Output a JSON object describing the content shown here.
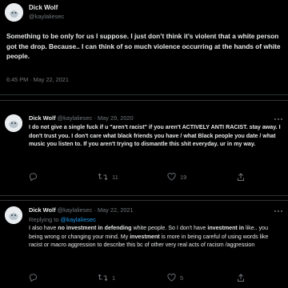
{
  "tweet1": {
    "display_name": "Dick Wolf",
    "handle": "@kaylaliesec",
    "text": "Something to be only for us I suppose. I just don’t think it’s violent that a white person got the drop. Because.. I can think of so much violence occurring at the hands of white people.",
    "timestamp": "6:45 PM · May 22, 2021"
  },
  "tweet2": {
    "display_name": "Dick Wolf",
    "handle": "@kaylaliesec",
    "dot": "·",
    "date": "May 29, 2020",
    "text_a": "I do not give a single fuck if u \"aren't racist\" if you aren't ",
    "text_b": "ACTIVELY ANTI RACIST",
    "text_c": ". stay away. I don't trust you. I don't care what black friends you have / what Black people you date / what music you listen to. If you aren't trying to dismantle this shit everyday. ur in my way.",
    "replies": "",
    "retweets": "11",
    "likes": "19"
  },
  "tweet3": {
    "display_name": "Dick Wolf",
    "handle": "@kaylaliesec",
    "dot": "·",
    "date": "May 22, 2021",
    "replying_prefix": "Replying to ",
    "replying_handle": "@kaylaliesec",
    "text_a": "I also have ",
    "text_b": "no investment in defending",
    "text_c": " white people. So I don't have ",
    "text_d": "investment in",
    "text_e": " like.. you being wrong or changing your mind. My ",
    "text_f": "investment",
    "text_g": " is more in being careful of using words like racist or macro aggression to describe this bc of other very real acts of racism /aggression",
    "replies": "",
    "retweets": "1",
    "likes": "5"
  },
  "icons": {
    "more": "more-icon",
    "reply": "reply-icon",
    "retweet": "retweet-icon",
    "like": "heart-icon",
    "share": "share-icon"
  }
}
